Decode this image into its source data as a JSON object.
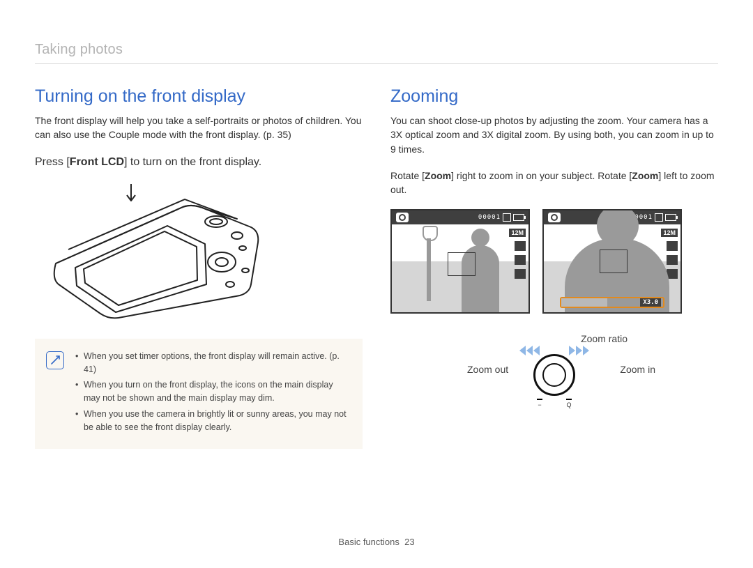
{
  "breadcrumb": "Taking photos",
  "left": {
    "heading": "Turning on the front display",
    "intro": "The front display will help you take a self-portraits or photos of children. You can also use the Couple mode with the front display. (p. 35)",
    "instruction_pre": "Press [",
    "instruction_bold": "Front LCD",
    "instruction_post": "] to turn on the front display.",
    "notes": [
      "When you set timer options, the front display will remain active. (p. 41)",
      "When you turn on the front display, the icons on the main display may not be shown and the main display may dim.",
      "When you use the camera in brightly lit or sunny areas, you may not be able to see the front display clearly."
    ]
  },
  "right": {
    "heading": "Zooming",
    "intro": "You can shoot close-up photos by adjusting the zoom. Your camera has a 3X optical zoom and 3X digital zoom. By using both, you can zoom in up to 9 times.",
    "instruction_pre": "Rotate [",
    "instruction_bold1": "Zoom",
    "instruction_mid": "] right to zoom in on your subject. Rotate [",
    "instruction_bold2": "Zoom",
    "instruction_post": "] left to zoom out.",
    "zoom_ratio_label": "Zoom ratio",
    "zoom_out_label": "Zoom out",
    "zoom_in_label": "Zoom in",
    "screen_counter": "00001",
    "screen_res": "12M",
    "zoom_value": "X3.0"
  },
  "footer": {
    "section": "Basic functions",
    "page": "23"
  }
}
